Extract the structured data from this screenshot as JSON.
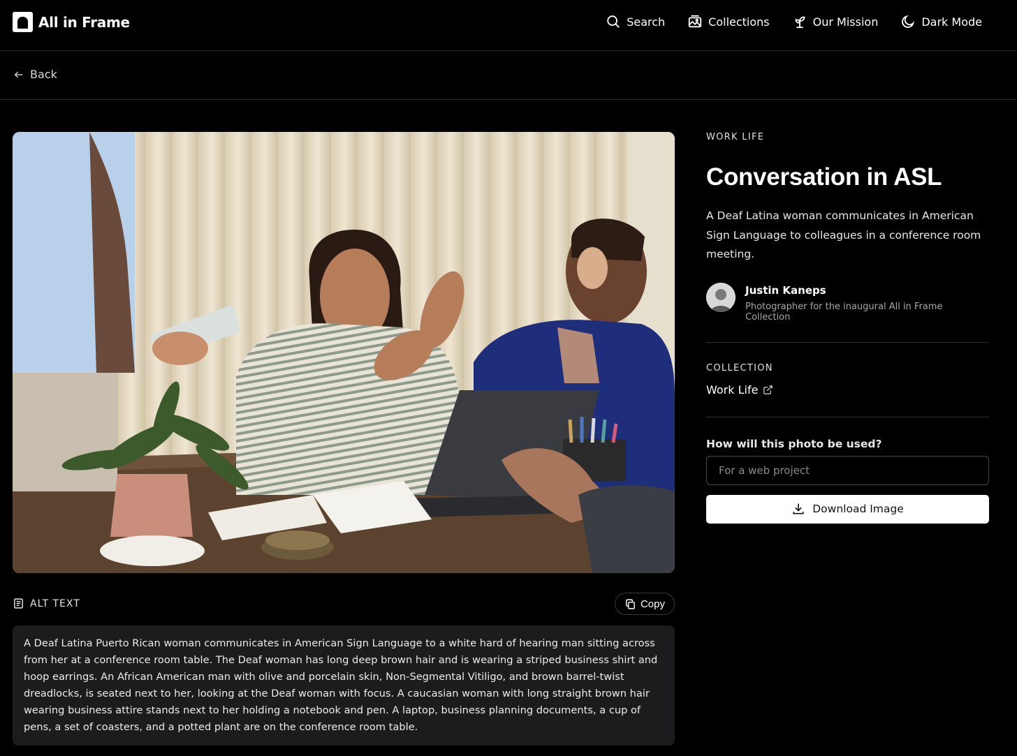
{
  "brand": {
    "name": "All in Frame"
  },
  "nav": {
    "search": "Search",
    "collections": "Collections",
    "mission": "Our Mission",
    "dark_mode": "Dark Mode"
  },
  "back_label": "Back",
  "photo": {
    "category": "WORK LIFE",
    "title": "Conversation in ASL",
    "description": "A Deaf Latina woman communicates in American Sign Language to colleagues in a conference room meeting."
  },
  "author": {
    "name": "Justin Kaneps",
    "role": "Photographer for the inaugural All in Frame Collection"
  },
  "collection": {
    "label": "COLLECTION",
    "name": "Work Life"
  },
  "usage": {
    "label": "How will this photo be used?",
    "placeholder": "For a web project"
  },
  "download_label": "Download Image",
  "alt_text": {
    "label": "ALT TEXT",
    "copy_label": "Copy",
    "body": "A Deaf Latina Puerto Rican woman communicates in American Sign Language to a white hard of hearing man sitting across from her at a conference room table. The Deaf woman has long deep brown hair and is wearing a striped business shirt and hoop earrings. An African American man with olive and porcelain skin, Non-Segmental Vitiligo, and brown barrel-twist dreadlocks, is seated next to her, looking at the Deaf woman with focus. A caucasian woman with long straight brown hair wearing business attire stands next to her holding a notebook and pen. A laptop, business planning documents, a cup of pens, a set of coasters, and a potted plant are on the conference room table."
  }
}
